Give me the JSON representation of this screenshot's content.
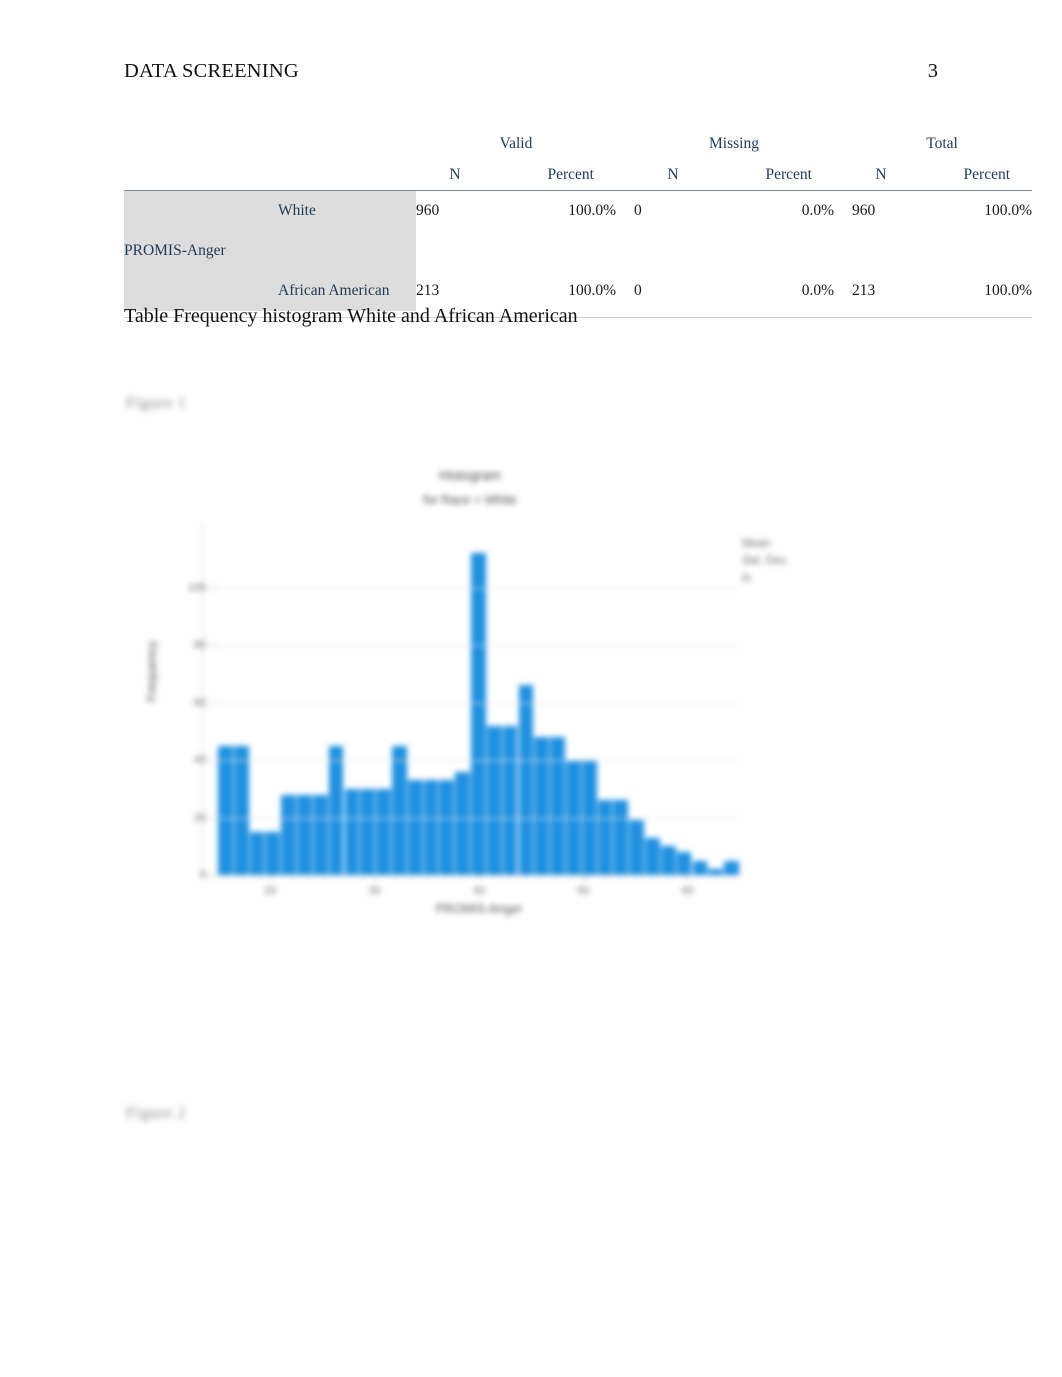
{
  "header": {
    "running_head": "DATA SCREENING",
    "page_number": "3"
  },
  "table": {
    "group_headers": [
      "Valid",
      "Missing",
      "Total"
    ],
    "sub_headers": [
      "N",
      "Percent",
      "N",
      "Percent",
      "N",
      "Percent"
    ],
    "row_group_label": "PROMIS-Anger",
    "rows": [
      {
        "category": "White",
        "valid_n": "960",
        "valid_percent": "100.0%",
        "missing_n": "0",
        "missing_percent": "0.0%",
        "total_n": "960",
        "total_percent": "100.0%"
      },
      {
        "category": "African American",
        "valid_n": "213",
        "valid_percent": "100.0%",
        "missing_n": "0",
        "missing_percent": "0.0%",
        "total_n": "213",
        "total_percent": "100.0%"
      }
    ],
    "header_color": "#1f3a55",
    "row_header_bg": "#dddddd"
  },
  "caption": "Table Frequency histogram White and African American",
  "figure_labels": {
    "first": "Figure 1",
    "second": "Figure 2"
  },
  "chart_data": {
    "type": "bar",
    "title": "Histogram",
    "subtitle": "for Race = White",
    "xlabel": "PROMIS-Anger",
    "ylabel": "Frequency",
    "bar_color": "#1e90e0",
    "grid": true,
    "legend_position": "top-right",
    "annotations": {
      "mean_label": "Mean",
      "std_label": "Std. Dev.",
      "n_label": "N"
    },
    "ylim": [
      0,
      120
    ],
    "yticks": [
      "0",
      "20",
      "40",
      "60",
      "80",
      "100"
    ],
    "xticks": [
      "20",
      "30",
      "40",
      "50",
      "60"
    ],
    "categories": [
      "b1",
      "b2",
      "b3",
      "b4",
      "b5",
      "b6",
      "b7",
      "b8",
      "b9",
      "b10",
      "b11",
      "b12",
      "b13",
      "b14",
      "b15",
      "b16",
      "b17",
      "b18",
      "b19",
      "b20",
      "b21",
      "b22",
      "b23",
      "b24",
      "b25",
      "b26",
      "b27",
      "b28",
      "b29",
      "b30",
      "b31",
      "b32",
      "b33"
    ],
    "values": [
      45,
      45,
      15,
      15,
      28,
      28,
      28,
      45,
      30,
      30,
      30,
      45,
      33,
      33,
      33,
      36,
      112,
      52,
      52,
      66,
      48,
      48,
      40,
      40,
      26,
      26,
      19,
      13,
      10,
      8,
      5,
      2,
      5
    ]
  }
}
